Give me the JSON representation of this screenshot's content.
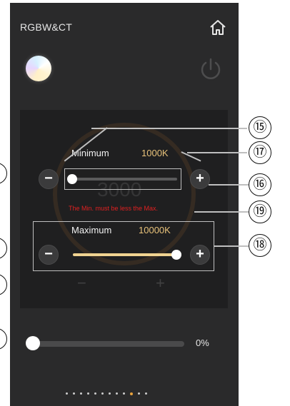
{
  "header": {
    "title": "RGBW&CT",
    "home_icon": "home-icon"
  },
  "controls": {
    "power_icon": "power-icon",
    "color_indicator": "color-orb"
  },
  "cct_panel": {
    "background_value": "3000",
    "minimum": {
      "label": "Minimum",
      "value": "1000K",
      "level": 0.0
    },
    "maximum": {
      "label": "Maximum",
      "value": "10000K",
      "level": 1.0
    },
    "error_message": "The Min. must be less the Max.",
    "minus_symbol": "−",
    "plus_symbol": "+"
  },
  "brightness": {
    "percent": "0%",
    "level": 0.0
  },
  "pager": {
    "count": 12,
    "active_index": 9
  },
  "callouts": [
    "⑮",
    "⑯",
    "⑰",
    "⑱",
    "⑲"
  ],
  "colors": {
    "accent": "#e8c27a",
    "error": "#e02020",
    "background": "#2a2a2b",
    "panel": "#1f1f20"
  }
}
